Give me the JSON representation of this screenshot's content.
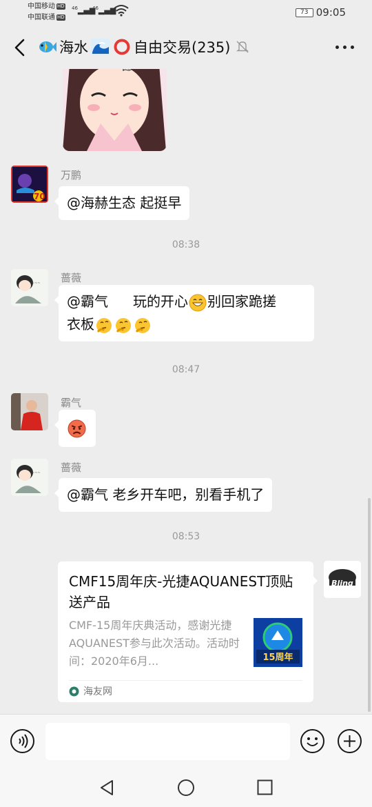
{
  "status_bar": {
    "carrier1": "中国移动",
    "carrier2": "中国联通",
    "hd": "HD",
    "signal1": "46",
    "signal2": "46",
    "battery": "73",
    "time": "09:05"
  },
  "header": {
    "title_part1": "海水",
    "title_part2": "自由交易(235)",
    "icons": [
      "back-icon",
      "fish-emoji",
      "wave-emoji",
      "hollow-circle-emoji",
      "mute-bell-icon",
      "more-icon"
    ]
  },
  "messages": [
    {
      "sender": "万鹏",
      "text": "@海赫生态  起挺早"
    },
    {
      "time": "08:38"
    },
    {
      "sender": "蔷薇",
      "text_a": "@霸气",
      "text_b": "玩的开心",
      "text_c": "别回家跪搓",
      "text_d": "衣板"
    },
    {
      "time": "08:47"
    },
    {
      "sender": "霸气"
    },
    {
      "sender": "蔷薇",
      "text": "@霸气  老乡开车吧，别看手机了"
    },
    {
      "time": "08:53"
    }
  ],
  "share_card": {
    "title": "CMF15周年庆-光捷AQUANEST顶贴送产品",
    "description": "CMF-15周年庆典活动，感谢光捷AQUANEST参与此次活动。活动时间：2020年6月...",
    "thumb_text": "15周年",
    "source": "海友网",
    "sender_avatar_text": "Bling"
  },
  "colors": {
    "background": "#ededed",
    "bubble": "#ffffff",
    "secondary_text": "#888888"
  }
}
